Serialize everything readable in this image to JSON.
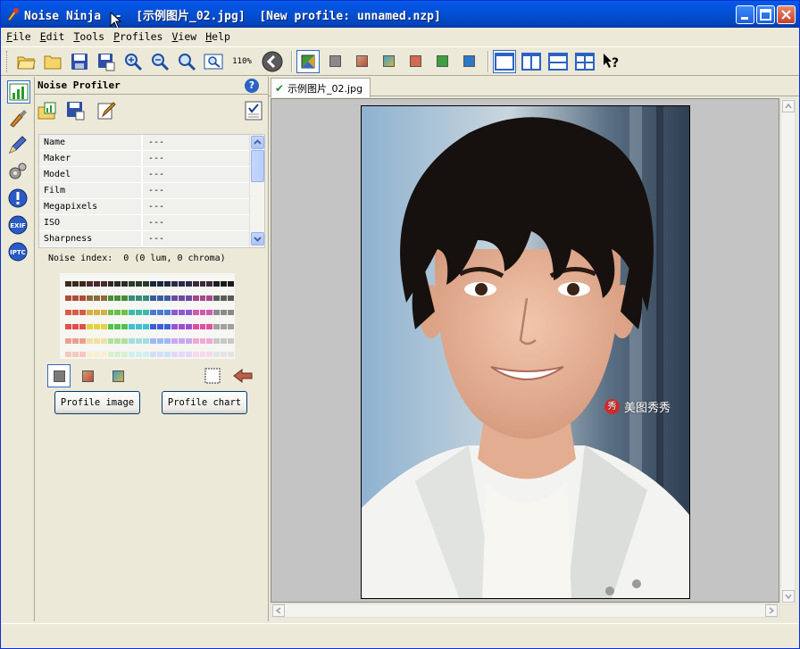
{
  "window": {
    "title": "Noise Ninja  -  [示例图片_02.jpg]  [New profile: unnamed.nzp]"
  },
  "menu": {
    "items": [
      "File",
      "Edit",
      "Tools",
      "Profiles",
      "View",
      "Help"
    ]
  },
  "toolbar": {
    "zoom": "110%",
    "buttons": [
      "open-image-icon",
      "open-folder-icon",
      "save-icon",
      "save-as-icon",
      "zoom-in-icon",
      "zoom-out-icon",
      "zoom-actual-icon",
      "zoom-fit-icon",
      "back-arrow-icon",
      "view-color-icon",
      "view-gray-icon",
      "view-red-icon",
      "view-blue-icon",
      "view-luma-icon",
      "view-green-icon",
      "view-cyan-icon",
      "layout-single-icon",
      "layout-split-vertical-icon",
      "layout-split-horizontal-icon",
      "layout-quad-icon",
      "help-context-icon"
    ]
  },
  "profiler": {
    "title": "Noise Profiler",
    "help": "?",
    "properties": [
      {
        "key": "Name",
        "value": "---"
      },
      {
        "key": "Maker",
        "value": "---"
      },
      {
        "key": "Model",
        "value": "---"
      },
      {
        "key": "Film",
        "value": "---"
      },
      {
        "key": "Megapixels",
        "value": "---"
      },
      {
        "key": "ISO",
        "value": "---"
      },
      {
        "key": "Sharpness",
        "value": "---"
      }
    ],
    "noise_index": "Noise index:  0 (0 lum, 0 chroma)",
    "profile_image_label": "Profile image",
    "profile_chart_label": "Profile chart"
  },
  "document": {
    "tab_label": "示例图片_02.jpg",
    "watermark_logo": "秀",
    "watermark_text": "美图秀秀"
  },
  "colors": {
    "titlebar": "#0350d2",
    "panel_bg": "#ece9d8",
    "viewport_bg": "#c4c4c4",
    "accent": "#316ac5"
  }
}
